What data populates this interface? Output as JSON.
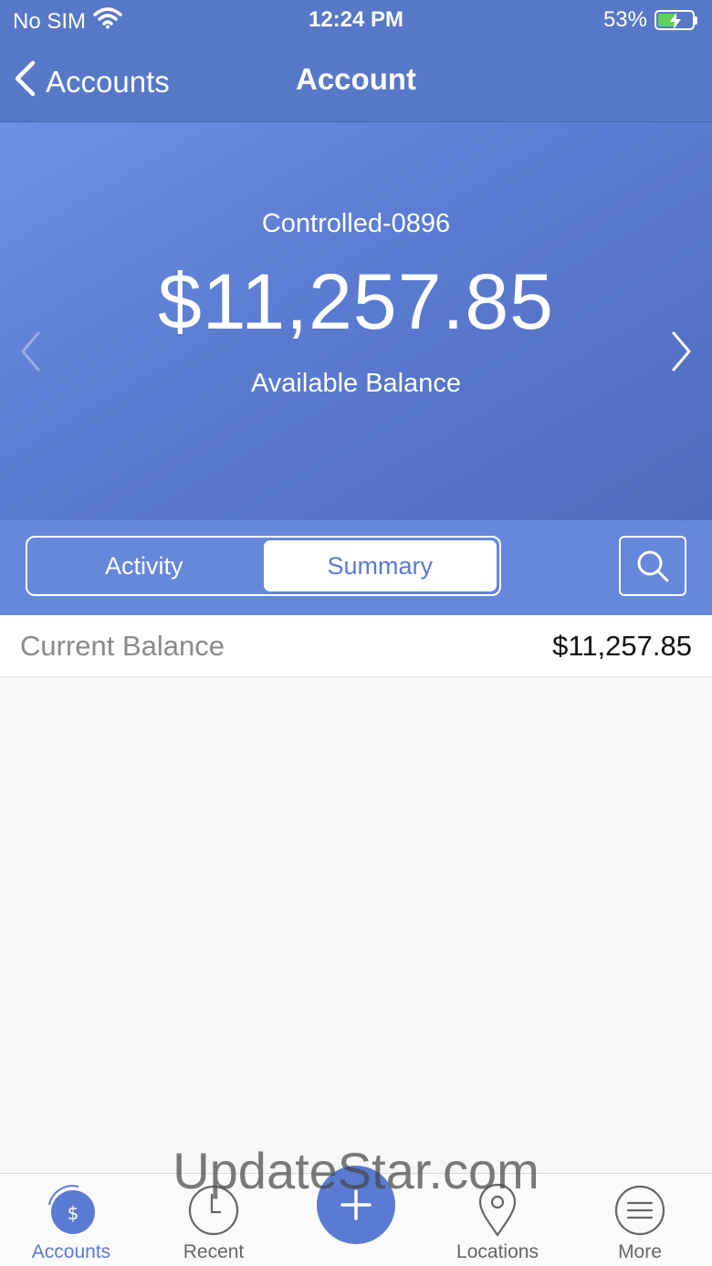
{
  "status_bar": {
    "carrier": "No SIM",
    "time": "12:24 PM",
    "battery_percent": "53%",
    "battery_level": 0.53
  },
  "nav": {
    "back_label": "Accounts",
    "title": "Account"
  },
  "hero": {
    "account_name": "Controlled-0896",
    "balance": "$11,257.85",
    "balance_label": "Available Balance"
  },
  "segments": {
    "activity": "Activity",
    "summary": "Summary",
    "selected": "summary"
  },
  "summary_rows": [
    {
      "label": "Current Balance",
      "value": "$11,257.85"
    }
  ],
  "watermark": "UpdateStar.com",
  "tabbar": {
    "accounts": "Accounts",
    "recent": "Recent",
    "locations": "Locations",
    "more": "More",
    "active": "accounts"
  },
  "colors": {
    "brand": "#5b7bd2",
    "header": "#5778c6",
    "segment_bar": "#6687dc",
    "battery_fill": "#5fd35a"
  },
  "icons": [
    "wifi-icon",
    "battery-icon",
    "back-chevron-icon",
    "prev-chevron-icon",
    "next-chevron-icon",
    "search-icon",
    "dollar-icon",
    "clock-icon",
    "plus-icon",
    "location-pin-icon",
    "menu-icon"
  ]
}
